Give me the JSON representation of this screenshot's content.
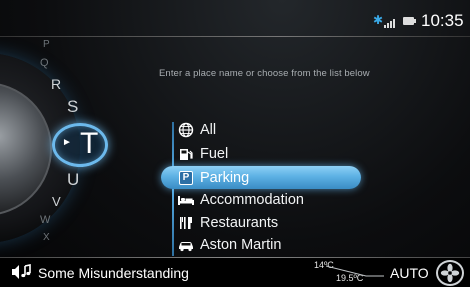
{
  "status_bar": {
    "clock": "10:35",
    "icons": [
      "bluetooth-icon",
      "signal-icon",
      "battery-icon"
    ]
  },
  "wheel": {
    "letters": [
      "P",
      "Q",
      "R",
      "S",
      "T",
      "U",
      "V",
      "W",
      "X"
    ],
    "selected": "T"
  },
  "hint": "Enter a place name or choose from the list below",
  "categories": [
    {
      "label": "All",
      "icon": "globe-icon"
    },
    {
      "label": "Fuel",
      "icon": "fuel-pump-icon"
    },
    {
      "label": "Parking",
      "icon": "parking-icon"
    },
    {
      "label": "Accommodation",
      "icon": "bed-icon"
    },
    {
      "label": "Restaurants",
      "icon": "cutlery-icon"
    },
    {
      "label": "Aston Martin",
      "icon": "car-icon"
    }
  ],
  "selected_category": "Parking",
  "parking_letter": "P",
  "bottom_bar": {
    "track": "Some Misunderstanding",
    "temp_outside": "14ºC",
    "temp_inside": "19.5ºC",
    "climate_mode": "AUTO"
  },
  "colors": {
    "accent": "#5db1e4",
    "bluetooth": "#3aa9e6"
  }
}
